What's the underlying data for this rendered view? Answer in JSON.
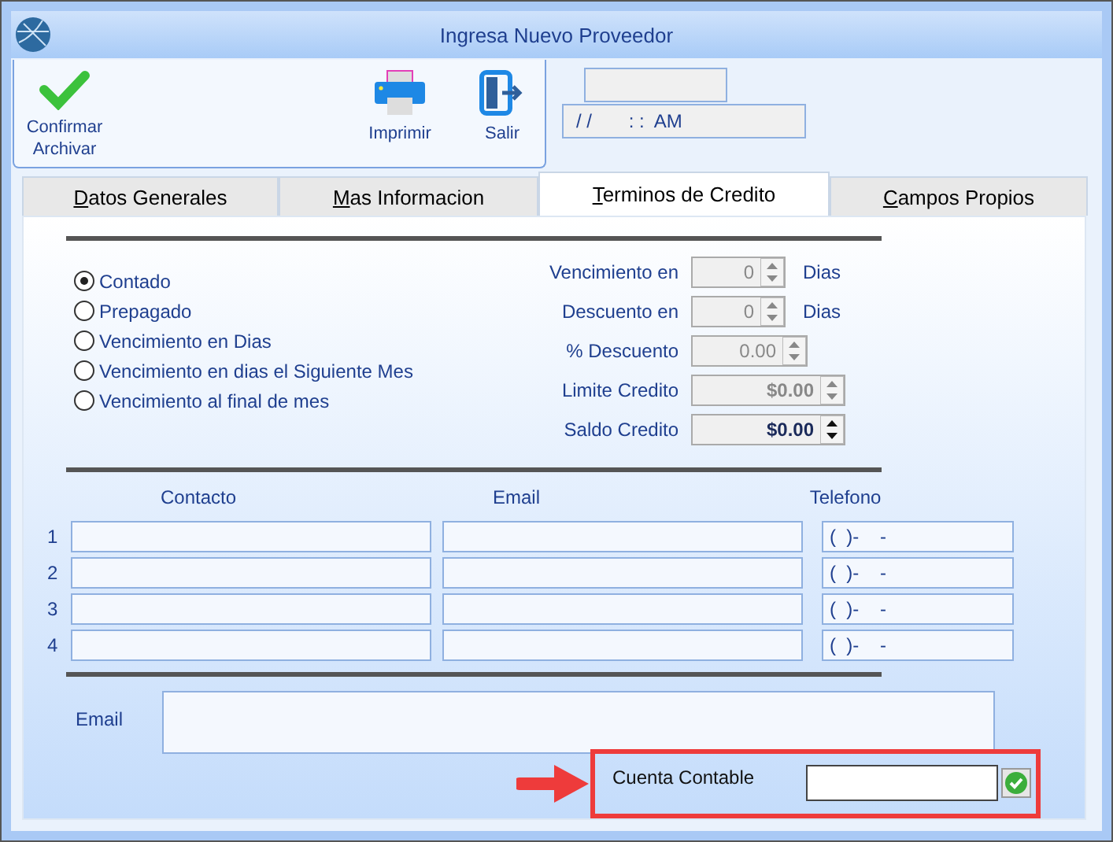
{
  "window": {
    "title": "Ingresa Nuevo Proveedor"
  },
  "toolbar": [
    {
      "kind": "confirm",
      "label": "Confirmar Archivar"
    },
    {
      "kind": "print",
      "label": "Imprimir"
    },
    {
      "kind": "exit",
      "label": "Salir"
    }
  ],
  "datetime": "/ /       : :  AM",
  "tabs": [
    {
      "label": "Datos Generales",
      "selected": false
    },
    {
      "label": "Mas Informacion",
      "selected": false
    },
    {
      "label": "Terminos de Credito",
      "selected": true
    },
    {
      "label": "Campos Propios",
      "selected": false
    }
  ],
  "payment_terms": [
    {
      "label": "Contado",
      "selected": true
    },
    {
      "label": "Prepagado",
      "selected": false
    },
    {
      "label": "Vencimiento en Dias",
      "selected": false
    },
    {
      "label": "Vencimiento en dias el Siguiente Mes",
      "selected": false
    },
    {
      "label": "Vencimiento al final de mes",
      "selected": false
    }
  ],
  "credit_fields": [
    {
      "label": "Vencimiento en",
      "value": "0",
      "suffix": "Dias",
      "disabled": true
    },
    {
      "label": "Descuento en",
      "value": "0",
      "suffix": "Dias",
      "disabled": true
    },
    {
      "label": "% Descuento",
      "value": "0.00",
      "disabled": true
    },
    {
      "label": "Limite Credito",
      "value": "$0.00",
      "disabled": true
    },
    {
      "label": "Saldo Credito",
      "value": "$0.00",
      "disabled": false
    }
  ],
  "contacts": {
    "columns": [
      "Contacto",
      "Email",
      "Telefono"
    ],
    "rows": [
      {
        "number": "1",
        "phone": "(  )-    -"
      },
      {
        "number": "2",
        "phone": "(  )-    -"
      },
      {
        "number": "3",
        "phone": "(  )-    -"
      },
      {
        "number": "4",
        "phone": "(  )-    -"
      }
    ]
  },
  "email": {
    "label": "Email"
  },
  "cuenta_contable": {
    "label": "Cuenta Contable",
    "highlighted": true
  }
}
